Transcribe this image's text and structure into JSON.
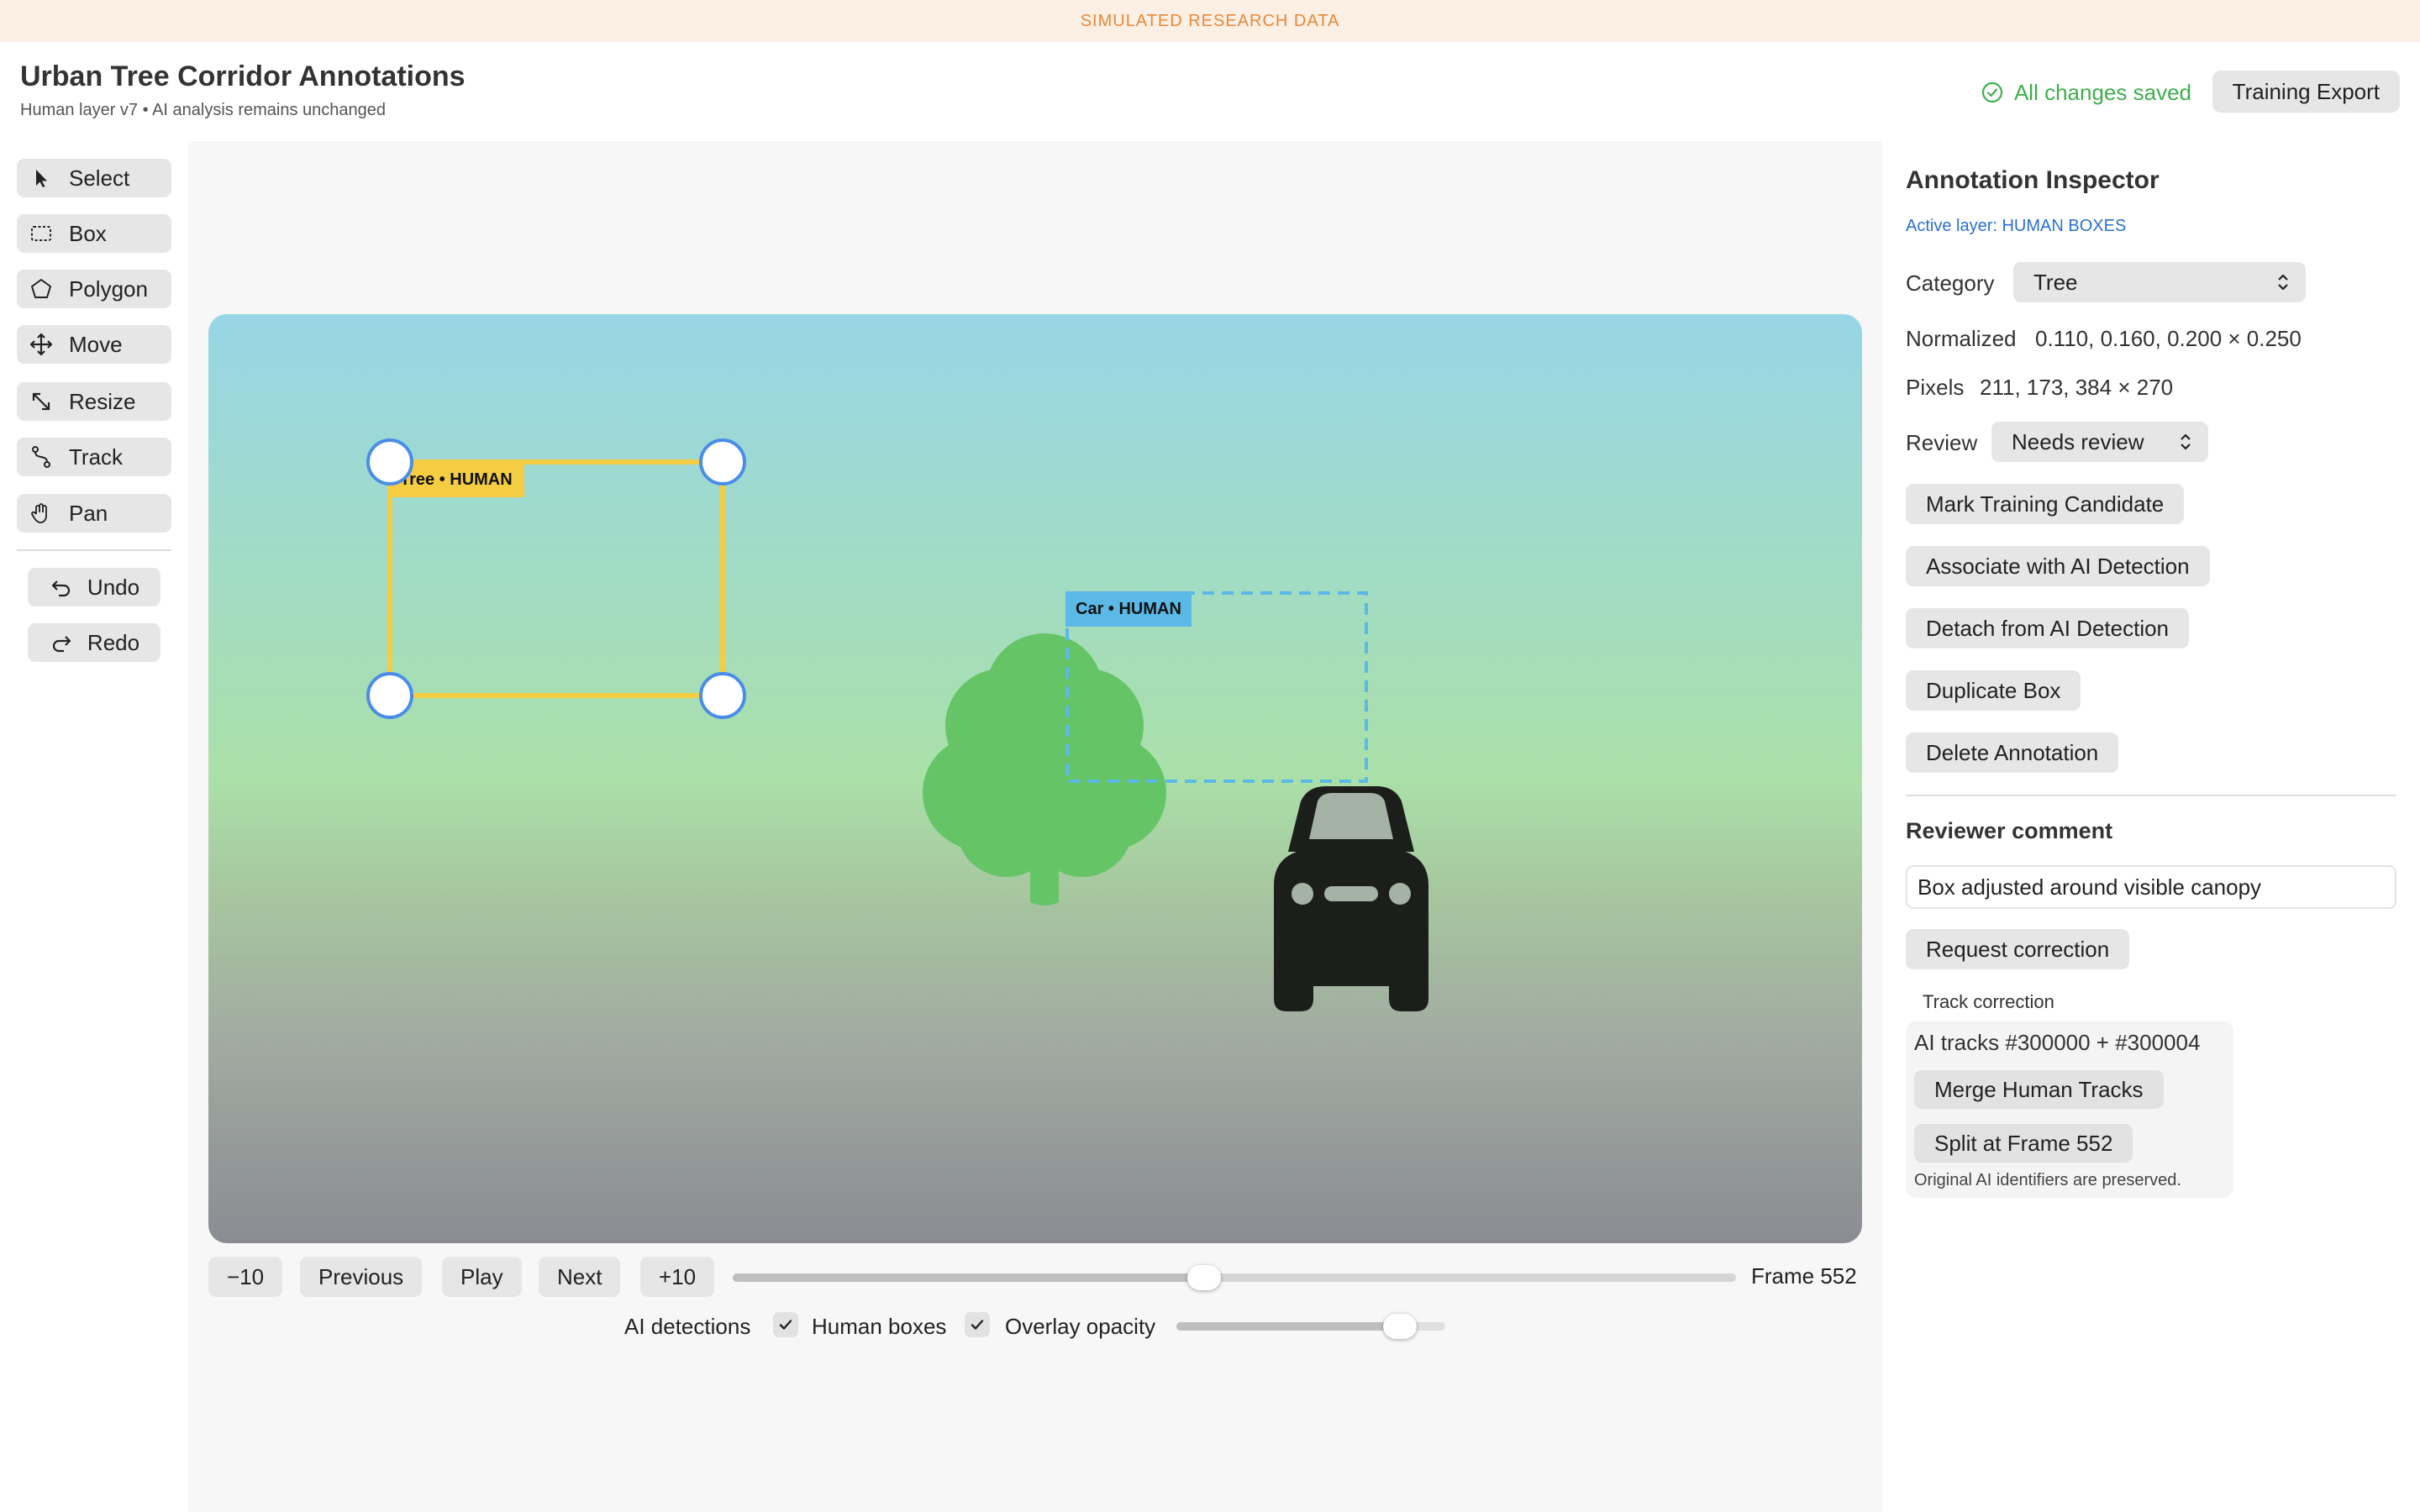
{
  "banner": "SIMULATED RESEARCH DATA",
  "header": {
    "title": "Urban Tree Corridor Annotations",
    "subtitle": "Human layer v7 • AI analysis remains unchanged",
    "save_status": "All changes saved",
    "export_label": "Training Export"
  },
  "tools": {
    "select": "Select",
    "box": "Box",
    "polygon": "Polygon",
    "move": "Move",
    "resize": "Resize",
    "track": "Track",
    "pan": "Pan",
    "undo": "Undo",
    "redo": "Redo"
  },
  "canvas": {
    "tree_label": "Tree • HUMAN",
    "car_label": "Car • HUMAN"
  },
  "playback": {
    "back10": "−10",
    "previous": "Previous",
    "play": "Play",
    "next": "Next",
    "fwd10": "+10",
    "frame_label": "Frame 552",
    "timeline_progress": 0.47
  },
  "overlays": {
    "ai_detections": "AI detections",
    "ai_detections_checked": true,
    "human_boxes": "Human boxes",
    "human_boxes_checked": true,
    "opacity_label": "Overlay opacity",
    "opacity_value": 0.83
  },
  "inspector": {
    "title": "Annotation Inspector",
    "active_layer": "Active layer: HUMAN BOXES",
    "category_label": "Category",
    "category_value": "Tree",
    "normalized_label": "Normalized",
    "normalized_value": "0.110, 0.160, 0.200 × 0.250",
    "pixels_label": "Pixels",
    "pixels_value": "211, 173, 384 × 270",
    "review_label": "Review",
    "review_value": "Needs review",
    "actions": {
      "mark_training": "Mark Training Candidate",
      "associate": "Associate with AI Detection",
      "detach": "Detach from AI Detection",
      "duplicate": "Duplicate Box",
      "delete": "Delete Annotation"
    },
    "comment_title": "Reviewer comment",
    "comment_value": "Box adjusted around visible canopy",
    "request_correction": "Request correction",
    "track": {
      "title": "Track correction",
      "ids": "AI tracks #300000 + #300004",
      "merge": "Merge Human Tracks",
      "split": "Split at Frame 552",
      "note": "Original AI identifiers are preserved."
    }
  },
  "colors": {
    "human_tree_box": "#f4cd43",
    "human_car_box": "#5ab9e6",
    "handle_border": "#4a8de8",
    "saved_green": "#3fae4f",
    "banner_text": "#e7893a",
    "active_layer_blue": "#2a6fd6"
  }
}
